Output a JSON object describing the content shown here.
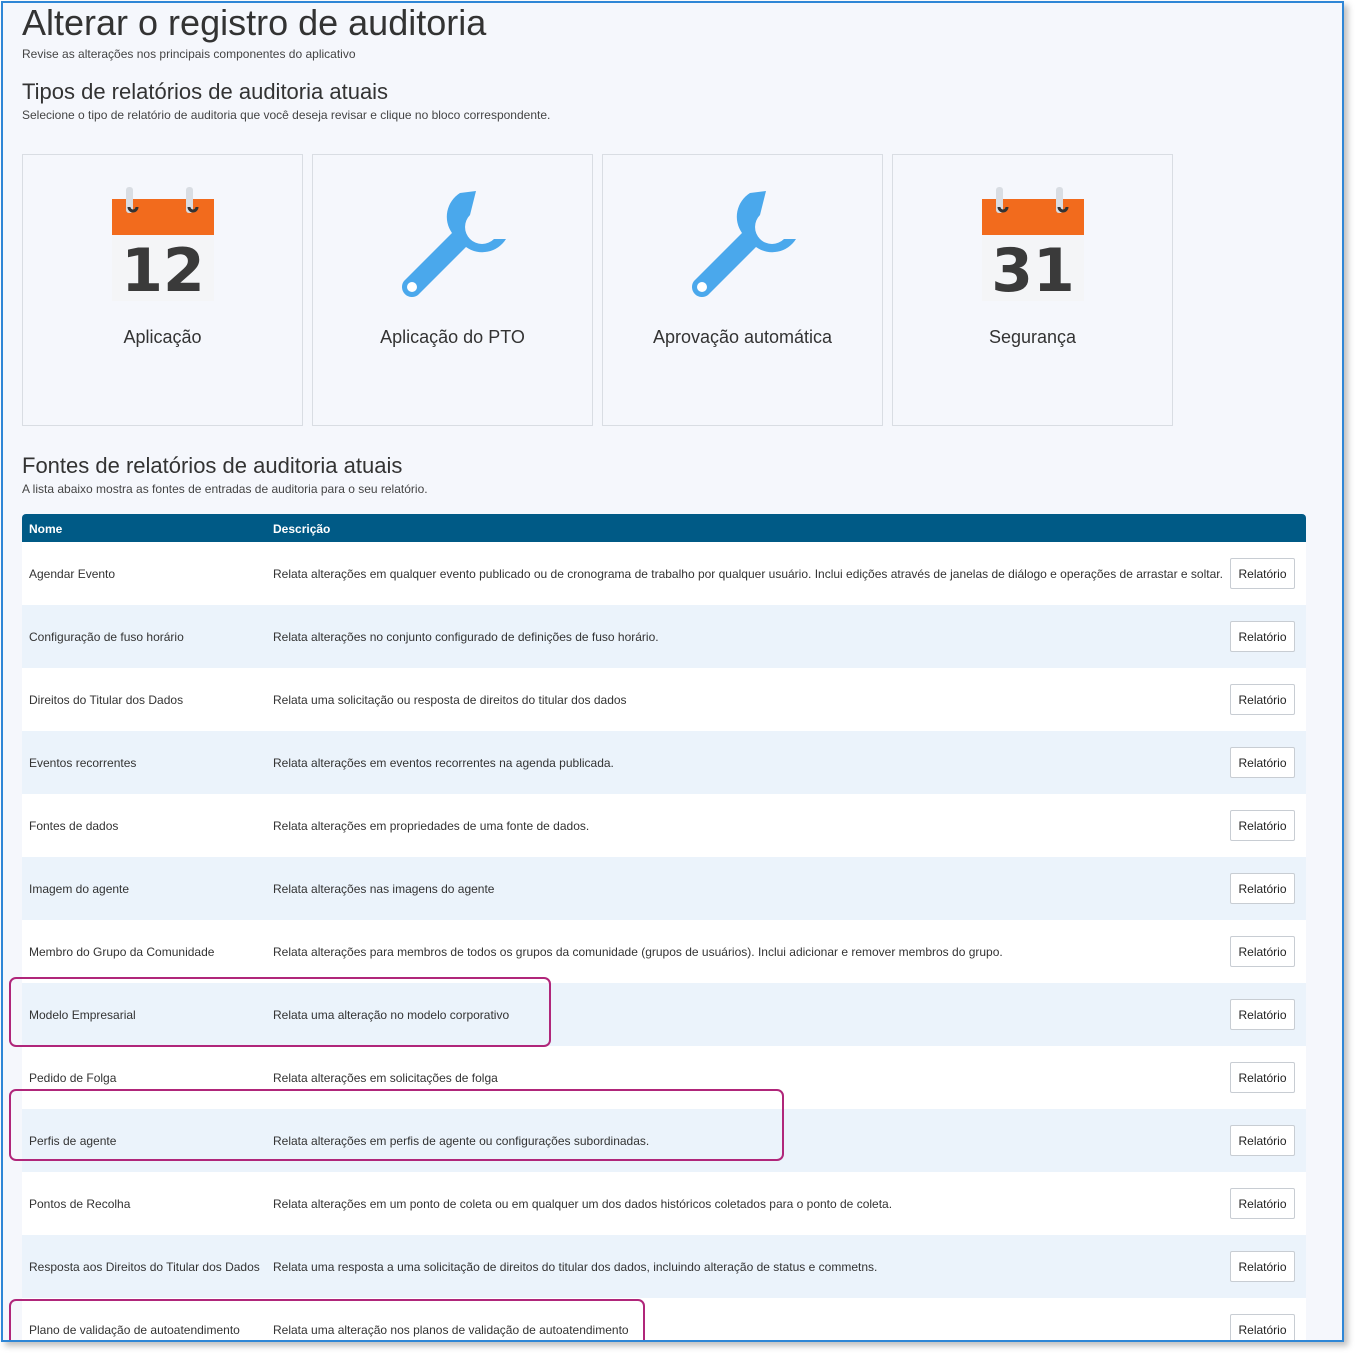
{
  "header": {
    "title": "Alterar o registro de auditoria",
    "subtitle": "Revise as alterações nos principais componentes do aplicativo"
  },
  "types_section": {
    "title": "Tipos de relatórios de auditoria atuais",
    "subtitle": "Selecione o tipo de relatório de auditoria que você deseja revisar e clique no bloco correspondente.",
    "tiles": [
      {
        "label": "Aplicação",
        "icon": "calendar-icon",
        "day": "12"
      },
      {
        "label": "Aplicação do PTO",
        "icon": "wrench-icon"
      },
      {
        "label": "Aprovação automática",
        "icon": "wrench-icon"
      },
      {
        "label": "Segurança",
        "icon": "calendar-icon",
        "day": "31"
      }
    ]
  },
  "sources_section": {
    "title": "Fontes de relatórios de auditoria atuais",
    "subtitle": "A lista abaixo mostra as fontes de entradas de auditoria para o seu relatório.",
    "columns": {
      "name": "Nome",
      "description": "Descrição"
    },
    "button_label": "Relatório",
    "rows": [
      {
        "name": "Agendar Evento",
        "description": "Relata alterações em qualquer evento publicado ou de cronograma de trabalho por qualquer usuário. Inclui edições através de janelas de diálogo e operações de arrastar e soltar."
      },
      {
        "name": "Configuração de fuso horário",
        "description": "Relata alterações no conjunto configurado de definições de fuso horário."
      },
      {
        "name": "Direitos do Titular dos Dados",
        "description": "Relata uma solicitação ou resposta de direitos do titular dos dados"
      },
      {
        "name": "Eventos recorrentes",
        "description": "Relata alterações em eventos recorrentes na agenda publicada."
      },
      {
        "name": "Fontes de dados",
        "description": "Relata alterações em propriedades de uma fonte de dados."
      },
      {
        "name": "Imagem do agente",
        "description": "Relata alterações nas imagens do agente"
      },
      {
        "name": "Membro do Grupo da Comunidade",
        "description": "Relata alterações para membros de todos os grupos da comunidade (grupos de usuários). Inclui adicionar e remover membros do grupo."
      },
      {
        "name": "Modelo Empresarial",
        "description": "Relata uma alteração no modelo corporativo"
      },
      {
        "name": "Pedido de Folga",
        "description": "Relata alterações em solicitações de folga"
      },
      {
        "name": "Perfis de agente",
        "description": "Relata alterações em perfis de agente ou configurações subordinadas."
      },
      {
        "name": "Pontos de Recolha",
        "description": "Relata alterações em um ponto de coleta ou em qualquer um dos dados históricos coletados para o ponto de coleta."
      },
      {
        "name": "Resposta aos Direitos do Titular dos Dados",
        "description": "Relata uma resposta a uma solicitação de direitos do titular dos dados, incluindo alteração de status e commetns."
      },
      {
        "name": "Plano de validação de autoatendimento",
        "description": "Relata uma alteração nos planos de validação de autoatendimento"
      }
    ]
  },
  "colors": {
    "table_header": "#005a86",
    "highlight_border": "#b0267a",
    "calendar_orange": "#f26b1d",
    "wrench_blue": "#4aa8ec"
  }
}
